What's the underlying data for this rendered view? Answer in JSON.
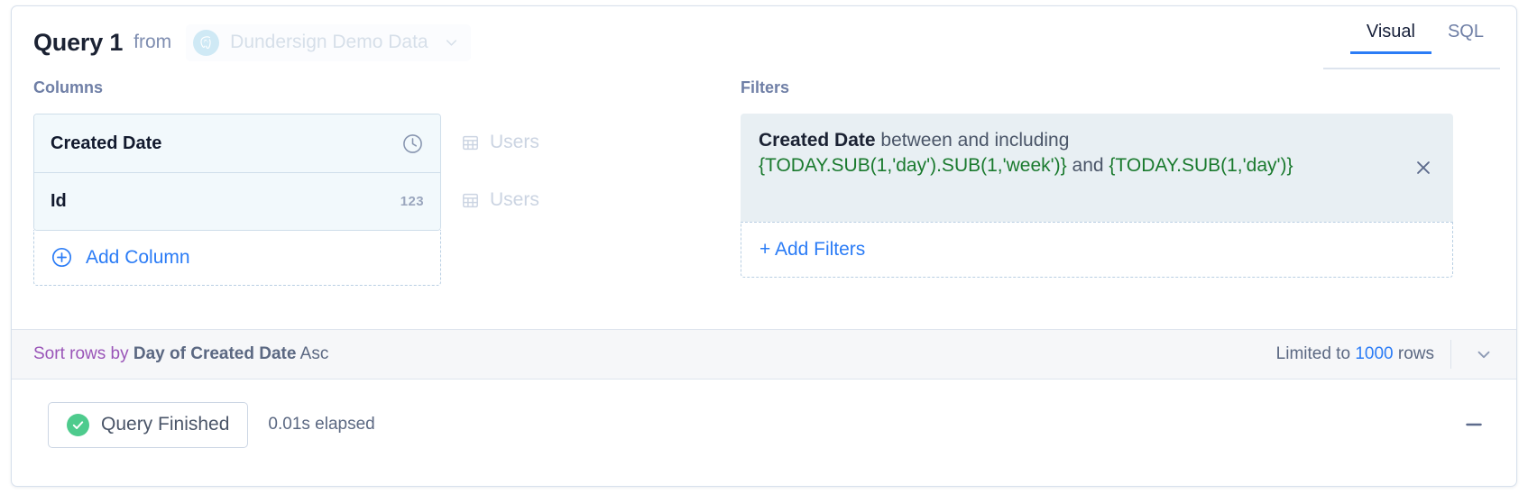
{
  "header": {
    "title": "Query 1",
    "from_label": "from",
    "datasource": {
      "name": "Dundersign Demo Data",
      "logo_icon": "postgresql-elephant-icon",
      "caret_icon": "chevron-down-icon"
    },
    "tabs": [
      {
        "label": "Visual",
        "active": true
      },
      {
        "label": "SQL",
        "active": false
      }
    ]
  },
  "columns": {
    "section_label": "Columns",
    "rows": [
      {
        "name": "Created Date",
        "type_icon": "clock-icon",
        "type_badge": "",
        "table": "Users",
        "table_icon": "table-icon"
      },
      {
        "name": "Id",
        "type_icon": "",
        "type_badge": "123",
        "table": "Users",
        "table_icon": "table-icon"
      }
    ],
    "add_label": "Add Column",
    "add_icon": "plus-circle-icon"
  },
  "filters": {
    "section_label": "Filters",
    "chip": {
      "field": "Created Date",
      "operator": "between and including",
      "value_start": "{TODAY.SUB(1,'day').SUB(1,'week')}",
      "conjunction": "and",
      "value_end": "{TODAY.SUB(1,'day')}",
      "close_icon": "close-x-icon"
    },
    "add_label": "+ Add Filters"
  },
  "sort_bar": {
    "sort_prefix": "Sort rows by",
    "sort_field": "Day of Created Date",
    "sort_direction": "Asc",
    "limit_prefix": "Limited to",
    "limit_count": "1000",
    "limit_suffix": "rows",
    "caret_icon": "chevron-down-icon"
  },
  "status_bar": {
    "status_label": "Query Finished",
    "status_icon": "check-circle-icon",
    "elapsed": "0.01s elapsed",
    "minimize_icon": "minimize-icon"
  },
  "colors": {
    "accent_blue": "#2b7cf6",
    "expression_green": "#1a7a2e",
    "sort_purple": "#9a55b8",
    "success_green": "#4ecb8d",
    "chip_bg": "#e8eff3",
    "row_bg": "#f2f9fc"
  }
}
